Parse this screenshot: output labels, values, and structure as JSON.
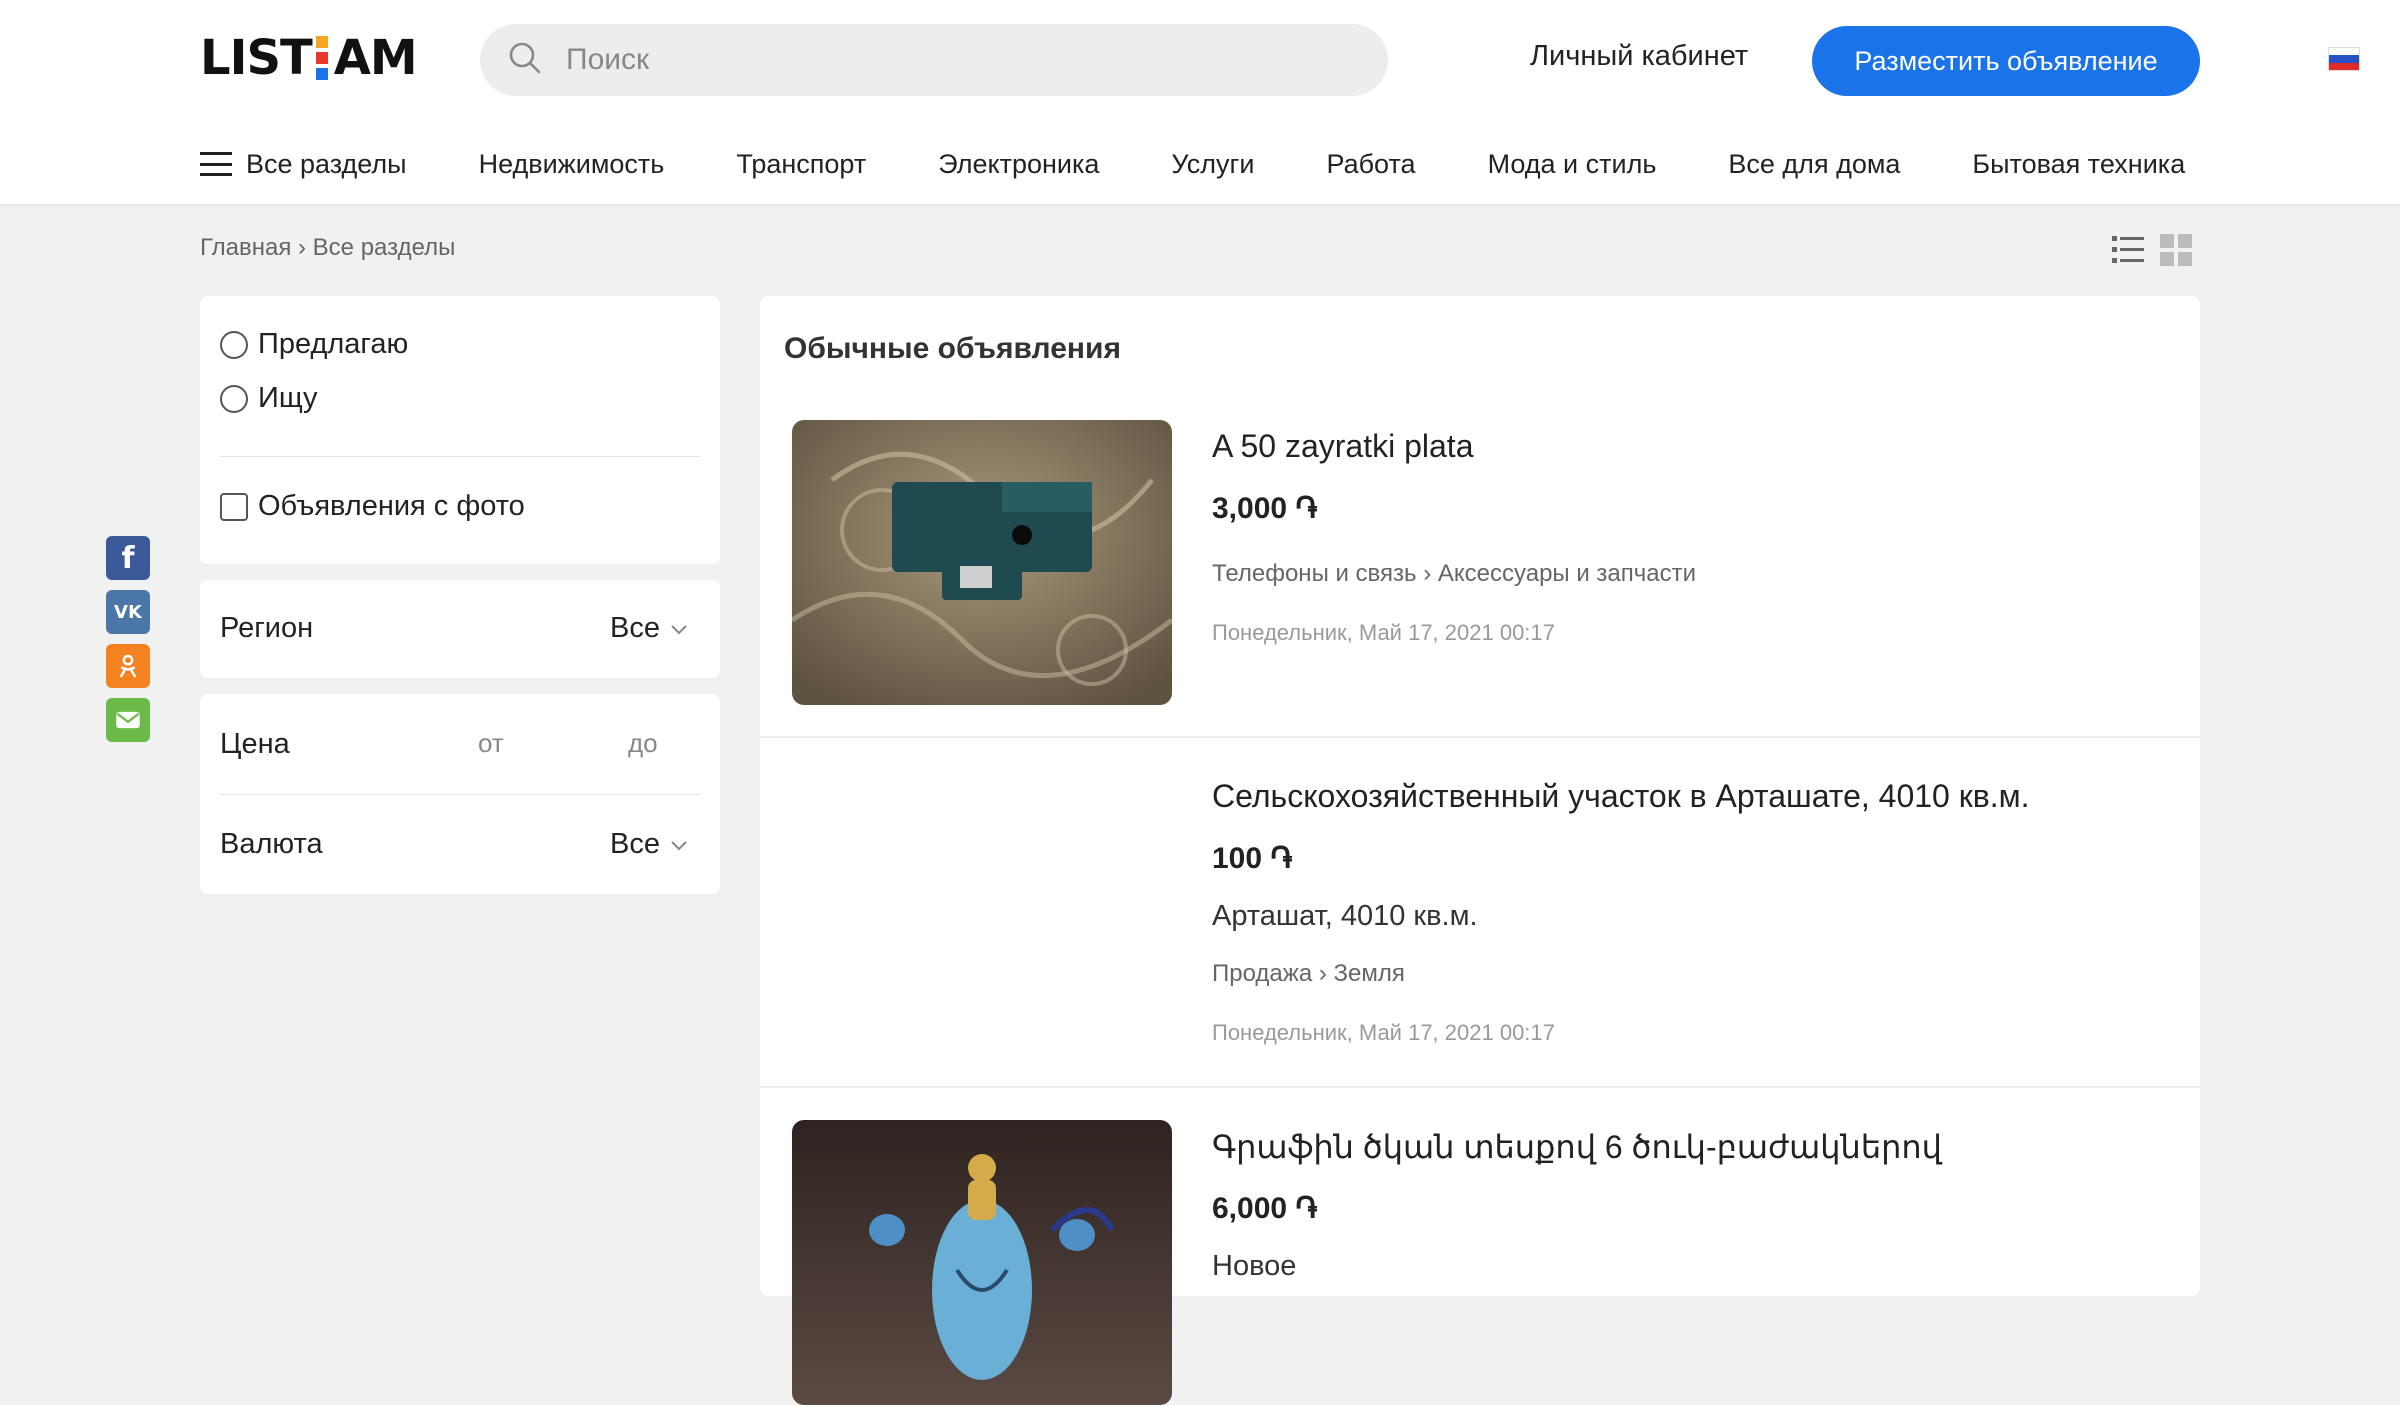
{
  "logo": {
    "left": "LIST",
    "right": "AM",
    "colors": [
      "#f6a623",
      "#e8372b",
      "#1a73e8"
    ]
  },
  "search": {
    "placeholder": "Поиск",
    "icon": "search-icon"
  },
  "header": {
    "cabinet": "Личный кабинет",
    "post_button": "Разместить объявление",
    "language_flag": "ru-flag-icon"
  },
  "nav": {
    "all": "Все разделы",
    "items": [
      "Недвижимость",
      "Транспорт",
      "Электроника",
      "Услуги",
      "Работа",
      "Мода и стиль",
      "Все для дома",
      "Бытовая техника"
    ]
  },
  "breadcrumb": "Главная › Все разделы",
  "social": [
    "facebook-icon",
    "vk-icon",
    "odnoklassniki-icon",
    "mail-icon"
  ],
  "filters": {
    "offer": "Предлагаю",
    "seek": "Ищу",
    "with_photo": "Объявления с фото",
    "region_label": "Регион",
    "region_value": "Все",
    "price_label": "Цена",
    "price_from": "от",
    "price_to": "до",
    "currency_label": "Валюта",
    "currency_value": "Все"
  },
  "listings": {
    "title": "Обычные объявления",
    "items": [
      {
        "title": "A 50 zayratki plata",
        "price": "3,000 ֏",
        "category": "Телефоны и связь › Аксессуары и запчасти",
        "date": "Понедельник, Май 17, 2021 00:17"
      },
      {
        "title": "Сельскохозяйственный участок в Арташате, 4010 кв.м.",
        "price": "100 ֏",
        "subtitle": "Арташат, 4010 кв.м.",
        "category": "Продажа › Земля",
        "date": "Понедельник, Май 17, 2021 00:17"
      },
      {
        "title": "Գրաֆին ծկան տեսքով 6 ծուկ-բաժակներով",
        "price": "6,000 ֏",
        "subtitle": "Новое"
      }
    ]
  },
  "colors": {
    "accent": "#1a73e8",
    "background": "#f1f1f1"
  }
}
